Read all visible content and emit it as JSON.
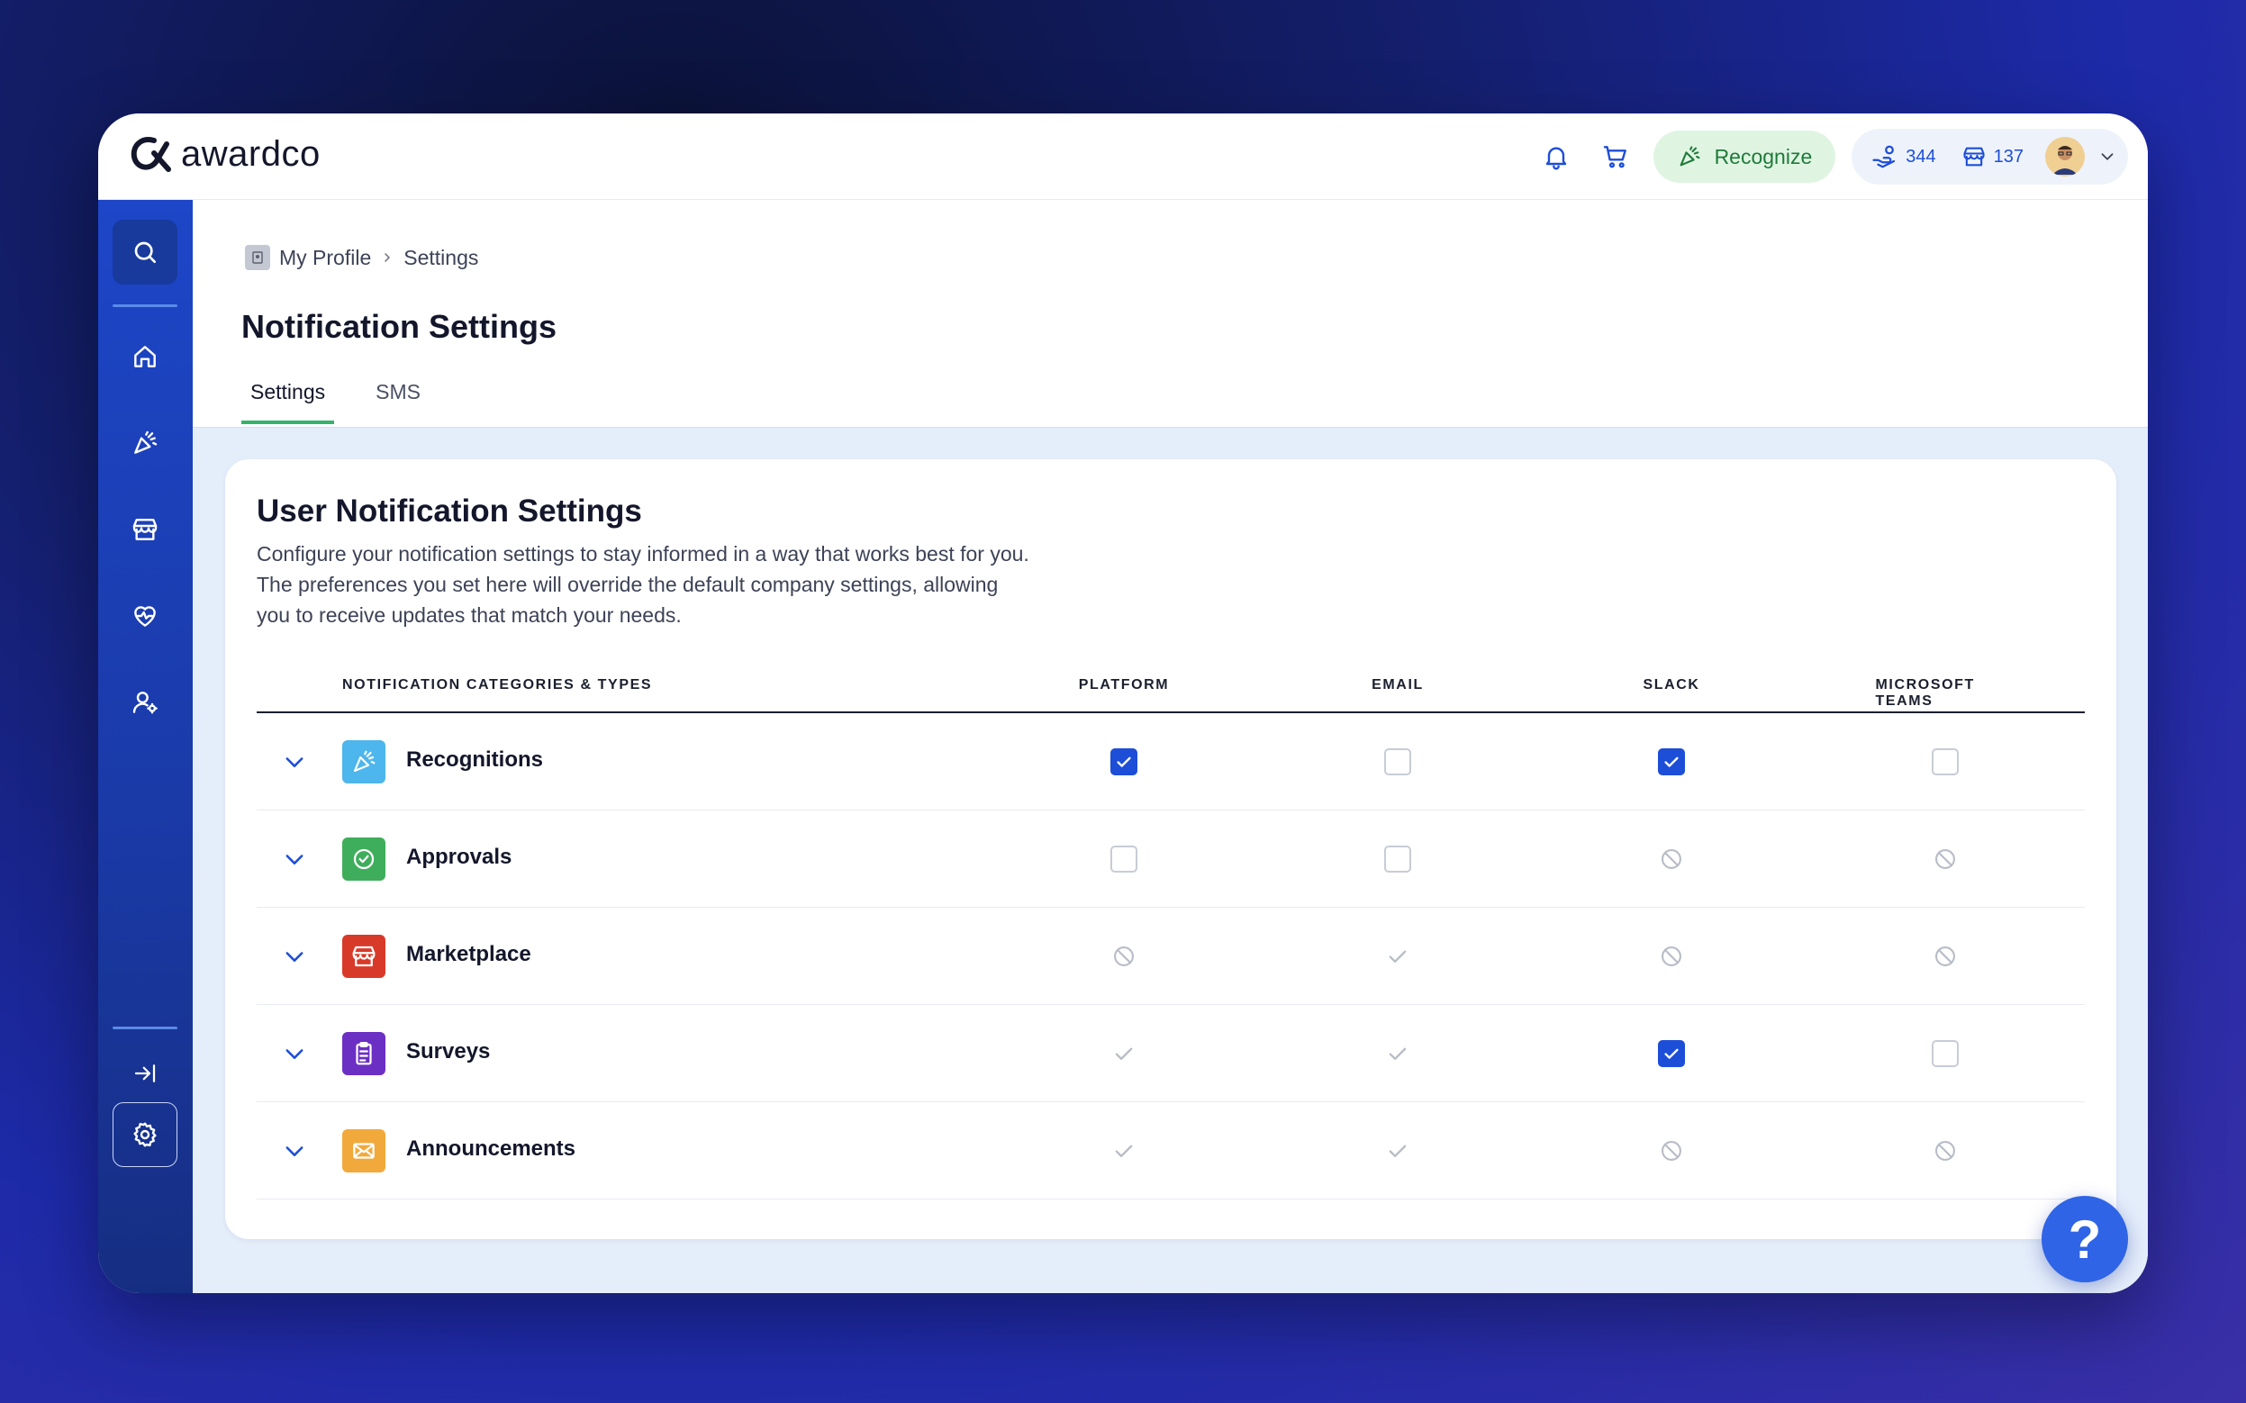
{
  "app": {
    "logo_text": "awardco"
  },
  "header": {
    "recognize_label": "Recognize",
    "points_balance": "344",
    "store_balance": "137"
  },
  "breadcrumb": {
    "parent": "My Profile",
    "current": "Settings"
  },
  "page_title": "Notification Settings",
  "tabs": [
    {
      "label": "Settings",
      "active": true
    },
    {
      "label": "SMS",
      "active": false
    }
  ],
  "card": {
    "title": "User Notification Settings",
    "description": "Configure your notification settings to stay informed in a way that works best for you. The preferences you set here will override the default company settings, allowing you to receive updates that match your needs."
  },
  "table": {
    "headers": {
      "category": "NOTIFICATION CATEGORIES & TYPES",
      "platform": "PLATFORM",
      "email": "EMAIL",
      "slack": "SLACK",
      "teams": "MICROSOFT TEAMS"
    },
    "rows": [
      {
        "label": "Recognitions",
        "icon": "party-popper-icon",
        "color": "#4db6ec",
        "platform": "checked",
        "email": "unchecked",
        "slack": "checked",
        "teams": "unchecked"
      },
      {
        "label": "Approvals",
        "icon": "check-circle-icon",
        "color": "#3fae5c",
        "platform": "unchecked",
        "email": "unchecked",
        "slack": "unavailable",
        "teams": "unavailable"
      },
      {
        "label": "Marketplace",
        "icon": "store-icon",
        "color": "#d83a2a",
        "platform": "unavailable",
        "email": "locked-on",
        "slack": "unavailable",
        "teams": "unavailable"
      },
      {
        "label": "Surveys",
        "icon": "clipboard-icon",
        "color": "#6b2fc4",
        "platform": "locked-on",
        "email": "locked-on",
        "slack": "checked",
        "teams": "unchecked"
      },
      {
        "label": "Announcements",
        "icon": "envelope-icon",
        "color": "#f2a93b",
        "platform": "locked-on",
        "email": "locked-on",
        "slack": "unavailable",
        "teams": "unavailable"
      }
    ]
  },
  "help_label": "?"
}
